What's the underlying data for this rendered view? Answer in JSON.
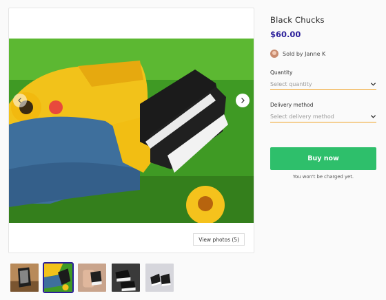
{
  "product": {
    "title": "Black Chucks",
    "price": "$60.00",
    "seller": "Sold by Janne K"
  },
  "form": {
    "quantity_label": "Quantity",
    "quantity_placeholder": "Select quantity",
    "delivery_label": "Delivery method",
    "delivery_placeholder": "Select delivery method"
  },
  "actions": {
    "buy_label": "Buy now",
    "charge_note": "You won't be charged yet."
  },
  "gallery": {
    "view_photos_label": "View photos (5)",
    "thumbnail_count": 5,
    "active_thumbnail": 2
  },
  "icons": {
    "prev": "chevron-left-icon",
    "next": "chevron-right-icon",
    "dropdown": "chevron-down-icon"
  },
  "colors": {
    "price": "#2b1f9a",
    "buy_button": "#2ebf6b",
    "field_underline": "#f0a020",
    "active_thumb_border": "#2b1f9a"
  }
}
